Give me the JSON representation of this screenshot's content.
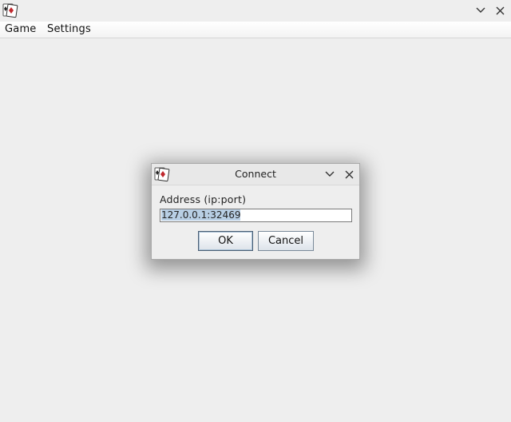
{
  "window": {
    "app_icon": "cards-app-icon",
    "minimize_icon": "chevron-down-icon",
    "close_icon": "close-icon"
  },
  "menubar": {
    "items": [
      {
        "label": "Game"
      },
      {
        "label": "Settings"
      }
    ]
  },
  "dialog": {
    "title": "Connect",
    "address_label": "Address (ip:port)",
    "address_value": "127.0.0.1:32469",
    "ok_label": "OK",
    "cancel_label": "Cancel"
  }
}
